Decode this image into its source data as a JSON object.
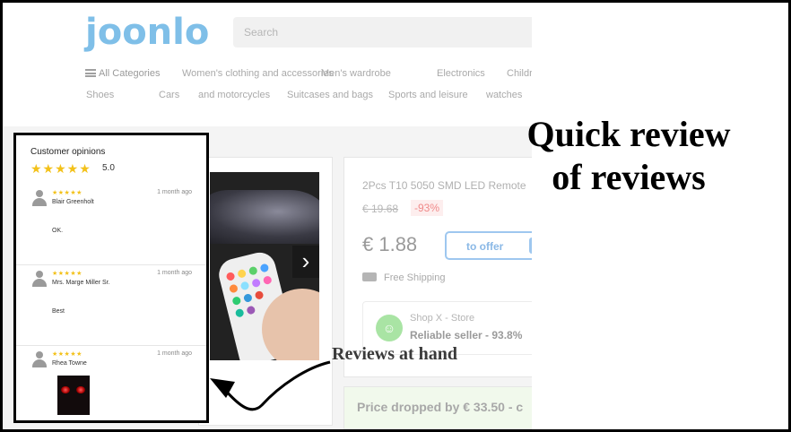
{
  "site": {
    "logo": "joonlo",
    "search_placeholder": "Search",
    "nav_row1": [
      "All Categories",
      "Women's clothing and accessories",
      "Men's wardrobe",
      "Electronics",
      "Childr"
    ],
    "nav_row2": [
      "Shoes",
      "Cars",
      "and motorcycles",
      "Suitcases and bags",
      "Sports and leisure",
      "watches"
    ]
  },
  "product": {
    "title": "2Pcs T10 5050 SMD LED Remote",
    "old_price": "€ 19.68",
    "discount": "-93%",
    "price": "€ 1.88",
    "offer_button": "to offer",
    "shipping": "Free Shipping",
    "store_name": "Shop X - Store",
    "seller_rating": "Reliable seller - 93.8%",
    "price_drop": "Price dropped by € 33.50 - c"
  },
  "reviews": {
    "title": "Customer opinions",
    "stars": "★★★★★",
    "score": "5.0",
    "items": [
      {
        "stars": "★★★★★",
        "name": "Blair Greenholt",
        "date": "1 month ago",
        "text": "OK."
      },
      {
        "stars": "★★★★★",
        "name": "Mrs. Marge Miller Sr.",
        "date": "1 month ago",
        "text": "Best"
      },
      {
        "stars": "★★★★★",
        "name": "Rhea Towne",
        "date": "1 month ago",
        "text": ""
      }
    ]
  },
  "annotations": {
    "headline_line1": "Quick review",
    "headline_line2": "of reviews",
    "hand_label": "Reviews at hand"
  },
  "colors": {
    "star": "#f3c119",
    "logo": "#7fbfe8",
    "offer": "#9ec7ef",
    "seller_badge": "#a9e4a4"
  }
}
